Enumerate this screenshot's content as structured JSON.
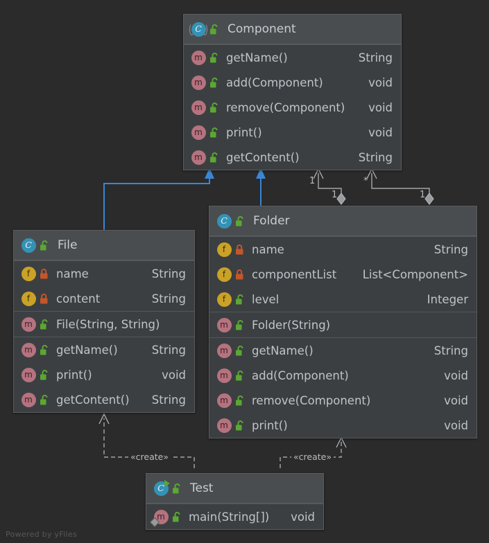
{
  "diagram": {
    "kind": "uml-class-diagram",
    "watermark": "Powered by yFiles",
    "background": "#2b2b2b",
    "inheritance_color": "#3a86d6",
    "association_color": "#b9bcbe",
    "dependency_color": "#b9bcbe"
  },
  "classes": {
    "component": {
      "name": "Component",
      "stereotype": "abstract",
      "icon": "class-abstract-icon",
      "visibility_icon": "unlock-icon",
      "compartments": [
        {
          "kind": "methods",
          "rows": [
            {
              "icon": "method-icon",
              "visibility": "unlock-icon",
              "name": "getName()",
              "type": "String"
            },
            {
              "icon": "method-icon",
              "visibility": "unlock-icon",
              "name": "add(Component)",
              "type": "void"
            },
            {
              "icon": "method-icon",
              "visibility": "unlock-icon",
              "name": "remove(Component)",
              "type": "void"
            },
            {
              "icon": "method-icon",
              "visibility": "unlock-icon",
              "name": "print()",
              "type": "void"
            },
            {
              "icon": "method-icon",
              "visibility": "unlock-icon",
              "name": "getContent()",
              "type": "String"
            }
          ]
        }
      ]
    },
    "file": {
      "name": "File",
      "stereotype": "class",
      "icon": "class-icon",
      "visibility_icon": "unlock-icon",
      "compartments": [
        {
          "kind": "fields",
          "rows": [
            {
              "icon": "field-icon",
              "visibility": "lock-icon",
              "name": "name",
              "type": "String"
            },
            {
              "icon": "field-icon",
              "visibility": "lock-icon",
              "name": "content",
              "type": "String"
            }
          ]
        },
        {
          "kind": "constructors",
          "rows": [
            {
              "icon": "method-icon",
              "visibility": "unlock-icon",
              "name": "File(String, String)",
              "type": ""
            }
          ]
        },
        {
          "kind": "methods",
          "rows": [
            {
              "icon": "method-icon",
              "visibility": "unlock-icon",
              "name": "getName()",
              "type": "String"
            },
            {
              "icon": "method-icon",
              "visibility": "unlock-icon",
              "name": "print()",
              "type": "void"
            },
            {
              "icon": "method-icon",
              "visibility": "unlock-icon",
              "name": "getContent()",
              "type": "String"
            }
          ]
        }
      ]
    },
    "folder": {
      "name": "Folder",
      "stereotype": "class",
      "icon": "class-icon",
      "visibility_icon": "unlock-icon",
      "compartments": [
        {
          "kind": "fields",
          "rows": [
            {
              "icon": "field-icon",
              "visibility": "lock-icon",
              "name": "name",
              "type": "String"
            },
            {
              "icon": "field-icon",
              "visibility": "lock-icon",
              "name": "componentList",
              "type": "List<Component>"
            },
            {
              "icon": "field-icon",
              "visibility": "unlock-icon",
              "name": "level",
              "type": "Integer"
            }
          ]
        },
        {
          "kind": "constructors",
          "rows": [
            {
              "icon": "method-icon",
              "visibility": "unlock-icon",
              "name": "Folder(String)",
              "type": ""
            }
          ]
        },
        {
          "kind": "methods",
          "rows": [
            {
              "icon": "method-icon",
              "visibility": "unlock-icon",
              "name": "getName()",
              "type": "String"
            },
            {
              "icon": "method-icon",
              "visibility": "unlock-icon",
              "name": "add(Component)",
              "type": "void"
            },
            {
              "icon": "method-icon",
              "visibility": "unlock-icon",
              "name": "remove(Component)",
              "type": "void"
            },
            {
              "icon": "method-icon",
              "visibility": "unlock-icon",
              "name": "print()",
              "type": "void"
            }
          ]
        }
      ]
    },
    "test": {
      "name": "Test",
      "stereotype": "runnable-class",
      "icon": "class-runnable-icon",
      "visibility_icon": "unlock-icon",
      "compartments": [
        {
          "kind": "methods",
          "rows": [
            {
              "icon": "method-static-icon",
              "visibility": "unlock-icon",
              "name": "main(String[])",
              "type": "void"
            }
          ]
        }
      ]
    }
  },
  "edges": [
    {
      "id": "file-extends-component",
      "type": "generalization",
      "from": "File",
      "to": "Component",
      "label": ""
    },
    {
      "id": "folder-extends-component",
      "type": "generalization",
      "from": "Folder",
      "to": "Component",
      "label": ""
    },
    {
      "id": "folder-has-component-1",
      "type": "aggregation",
      "from": "Folder",
      "to": "Component",
      "source_multiplicity": "1",
      "target_multiplicity": "1"
    },
    {
      "id": "folder-has-component-2",
      "type": "aggregation",
      "from": "Folder",
      "to": "Component",
      "source_multiplicity": "1",
      "target_multiplicity": "*"
    },
    {
      "id": "test-creates-file",
      "type": "dependency",
      "from": "Test",
      "to": "File",
      "label": "«create»"
    },
    {
      "id": "test-creates-folder",
      "type": "dependency",
      "from": "Test",
      "to": "Folder",
      "label": "«create»"
    }
  ]
}
